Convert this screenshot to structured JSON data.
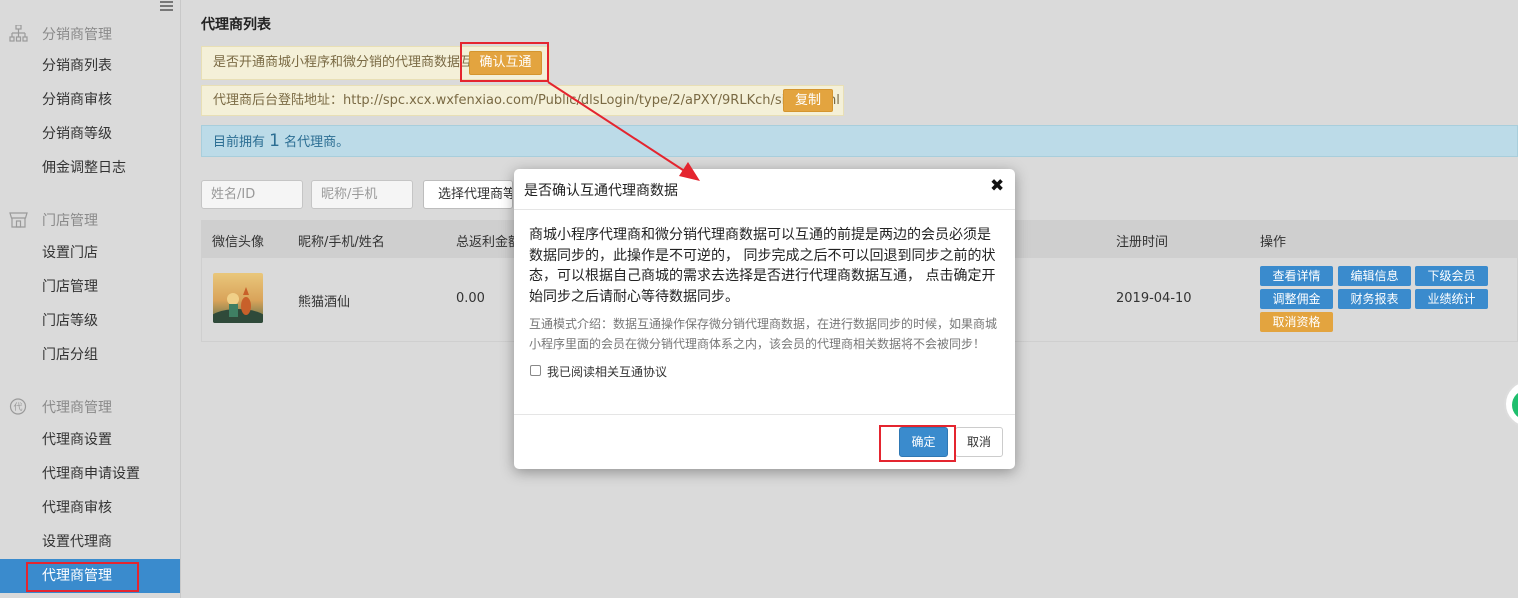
{
  "sidebar": {
    "groups": [
      {
        "label": "分销商管理",
        "icon": "org-chart-icon"
      },
      {
        "label": "门店管理",
        "icon": "store-icon"
      },
      {
        "label": "代理商管理",
        "icon": "agent-icon"
      }
    ],
    "items": [
      "分销商列表",
      "分销商审核",
      "分销商等级",
      "佣金调整日志",
      "设置门店",
      "门店管理",
      "门店等级",
      "门店分组",
      "代理商设置",
      "代理商申请设置",
      "代理商审核",
      "设置代理商",
      "代理商管理"
    ],
    "active_item": "代理商管理",
    "group_badge": "代"
  },
  "main": {
    "title": "代理商列表",
    "notice1": "是否开通商城小程序和微分销的代理商数据互通",
    "confirm_interop_button": "确认互通",
    "notice2": "代理商后台登陆地址：http://spc.xcx.wxfenxiao.com/Public/dlsLogin/type/2/aPXY/9RLKch/sid/6.html",
    "copy_button": "复制",
    "info_prefix": "目前拥有",
    "info_count": "1",
    "info_suffix": "名代理商。",
    "filters": {
      "name_placeholder": "姓名/ID",
      "nick_placeholder": "昵称/手机",
      "level_select": "选择代理商等级"
    },
    "table": {
      "headers": [
        "微信头像",
        "昵称/手机/姓名",
        "总返利金额",
        "注册时间",
        "操作"
      ],
      "rows": [
        {
          "nickname": "熊猫酒仙",
          "total_rebate": "0.00",
          "register_date": "2019-04-10",
          "actions": [
            "查看详情",
            "编辑信息",
            "下级会员",
            "调整佣金",
            "财务报表",
            "业绩统计",
            "取消资格"
          ]
        }
      ]
    }
  },
  "modal": {
    "title": "是否确认互通代理商数据",
    "close_glyph": "✖",
    "body_main": "商城小程序代理商和微分销代理商数据可以互通的前提是两边的会员必须是数据同步的，此操作是不可逆的， 同步完成之后不可以回退到同步之前的状态，可以根据自己商城的需求去选择是否进行代理商数据互通， 点击确定开始同步之后请耐心等待数据同步。",
    "body_sub": "互通模式介绍：数据互通操作保存微分销代理商数据，在进行数据同步的时候，如果商城小程序里面的会员在微分销代理商体系之内，该会员的代理商相关数据将不会被同步！",
    "checkbox_label": "我已阅读相关互通协议",
    "checkbox_checked": false,
    "ok_button": "确定",
    "cancel_button": "取消"
  },
  "colors": {
    "primary_blue": "#3a8bcd",
    "accent_orange": "#e3a43f",
    "annotation_red": "#e4252f",
    "overlay_gray": "#dadada"
  }
}
